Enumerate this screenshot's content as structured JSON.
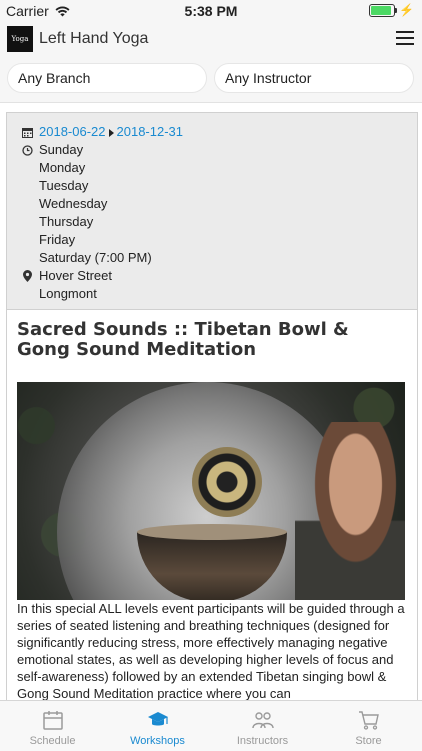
{
  "status_bar": {
    "carrier": "Carrier",
    "time": "5:38 PM",
    "battery_level": 1.0
  },
  "header": {
    "app_title": "Left Hand Yoga",
    "logo_text": "Yoga"
  },
  "filters": {
    "branch": "Any Branch",
    "instructor": "Any Instructor"
  },
  "event": {
    "start_date": "2018-06-22",
    "end_date": "2018-12-31",
    "days": [
      "Sunday",
      "Monday",
      "Tuesday",
      "Wednesday",
      "Thursday",
      "Friday",
      "Saturday (7:00 PM)"
    ],
    "location_street": "Hover Street",
    "location_city": "Longmont",
    "title": "Sacred Sounds :: Tibetan Bowl & Gong Sound Meditation",
    "description": "In this special ALL levels event participants will be guided through a series of seated listening and breathing techniques (designed for significantly reducing stress, more effectively managing negative emotional states, as well as developing higher levels of focus and self-awareness) followed by an extended Tibetan singing bowl & Gong Sound Meditation practice where you can"
  },
  "tabs": [
    {
      "label": "Schedule",
      "icon": "calendar-icon",
      "active": false
    },
    {
      "label": "Workshops",
      "icon": "graduation-cap-icon",
      "active": true
    },
    {
      "label": "Instructors",
      "icon": "people-icon",
      "active": false
    },
    {
      "label": "Store",
      "icon": "cart-icon",
      "active": false
    }
  ],
  "colors": {
    "accent": "#1a8ad0",
    "inactive": "#9a9a9a",
    "battery": "#4cd964"
  }
}
